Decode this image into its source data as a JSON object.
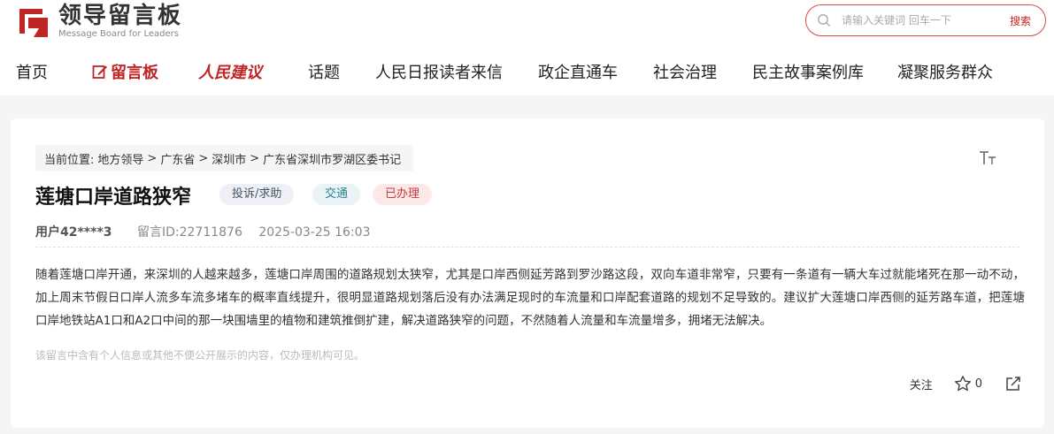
{
  "header": {
    "logo_cn": "领导留言板",
    "logo_en": "Message Board for Leaders",
    "search_placeholder": "请输入关键词 回车一下",
    "search_button": "搜索",
    "brand_color": "#c02525"
  },
  "nav": {
    "items": [
      {
        "label": "首页"
      },
      {
        "label": "留言板",
        "icon": "edit-icon"
      },
      {
        "label": "人民建议"
      },
      {
        "label": "话题"
      },
      {
        "label": "人民日报读者来信"
      },
      {
        "label": "政企直通车"
      },
      {
        "label": "社会治理"
      },
      {
        "label": "民主故事案例库"
      },
      {
        "label": "凝聚服务群众"
      }
    ]
  },
  "breadcrumb": {
    "prefix": "当前位置:",
    "items": [
      "地方领导",
      "广东省",
      "深圳市",
      "广东省深圳市罗湖区委书记"
    ],
    "separator": ">"
  },
  "message": {
    "title": "莲塘口岸道路狭窄",
    "tags": [
      "投诉/求助",
      "交通",
      "已办理"
    ],
    "user": "用户42****3",
    "id": "留言ID:22711876",
    "datetime": "2025-03-25 16:03",
    "content": "随着莲塘口岸开通，来深圳的人越来越多，莲塘口岸周围的道路规划太狭窄，尤其是口岸西侧延芳路到罗沙路这段，双向车道非常窄，只要有一条道有一辆大车过就能堵死在那一动不动，加上周末节假日口岸人流多车流多堵车的概率直线提升，很明显道路规划落后没有办法满足现时的车流量和口岸配套道路的规划不足导致的。建议扩大莲塘口岸西侧的延芳路车道，把莲塘口岸地铁站A1口和A2口中间的那一块围墙里的植物和建筑推倒扩建，解决道路狭窄的问题，不然随着人流量和车流量增多，拥堵无法解决。",
    "notice": "该留言中含有个人信息或其他不便公开展示的内容，仅办理机构可见。"
  },
  "actions": {
    "follow": "关注",
    "star_count": "0"
  }
}
